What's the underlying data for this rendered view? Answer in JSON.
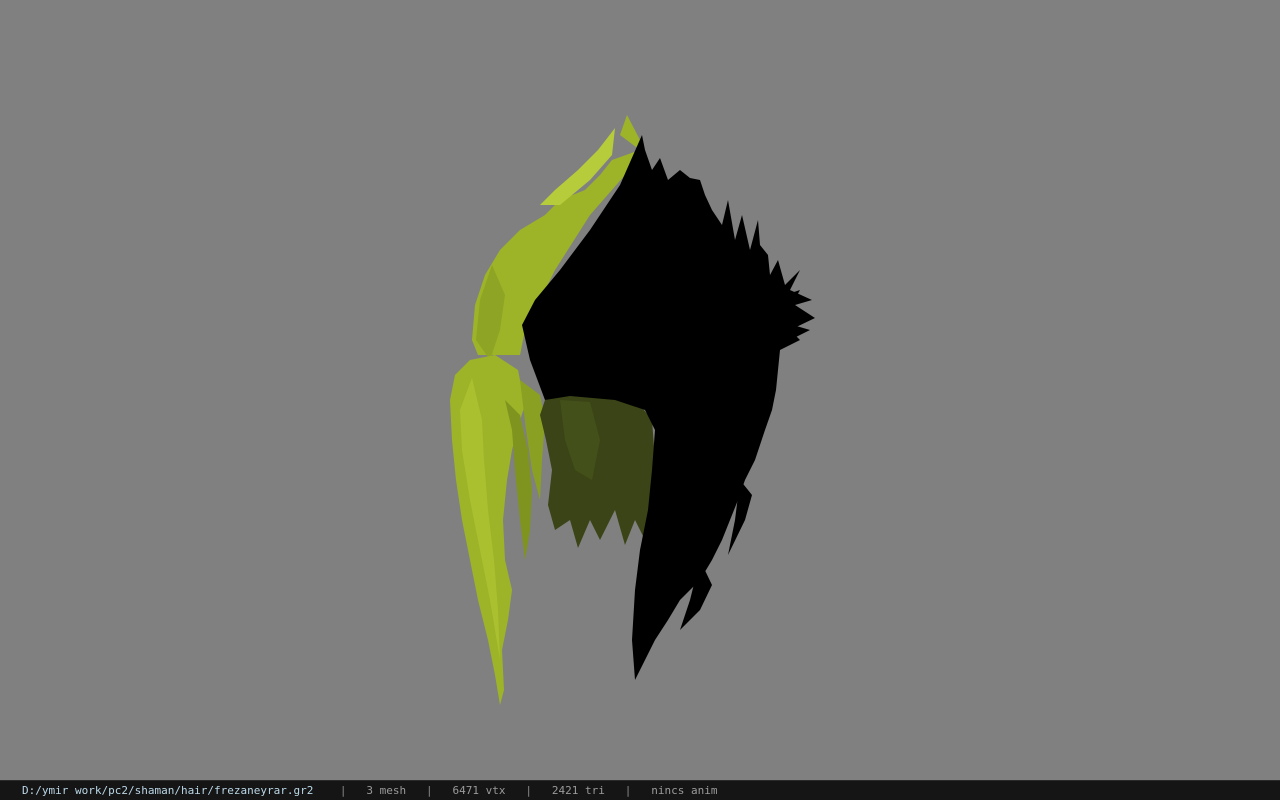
{
  "viewer": {
    "background_color": "#808080",
    "model": {
      "description_icon": "hair-mesh",
      "colors": {
        "lit": "#9db428",
        "lit_highlight": "#b7cc3a",
        "mid": "#6f8219",
        "shadow": "#3a4416",
        "unlit": "#000000"
      }
    }
  },
  "statusbar": {
    "file_path": "D:/ymir work/pc2/shaman/hair/frezaneyrar.gr2",
    "separator": "|",
    "mesh_count": "3 mesh",
    "vertex_count": "6471 vtx",
    "triangle_count": "2421 tri",
    "anim_status": "nincs anim"
  }
}
